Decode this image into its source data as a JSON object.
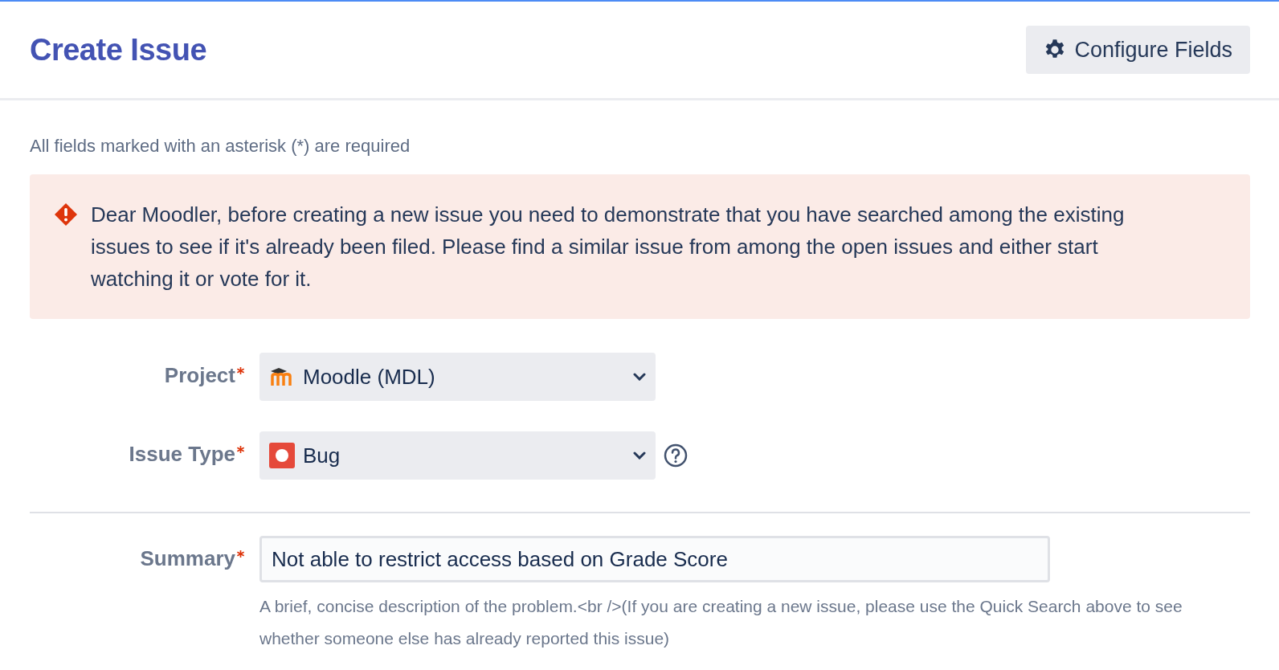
{
  "header": {
    "title": "Create Issue",
    "configure_button": "Configure Fields"
  },
  "required_note": "All fields marked with an asterisk (*) are required",
  "alert": {
    "kind": "error",
    "message": "Dear Moodler, before creating a new issue you need to demonstrate that you have searched among the existing issues to see if it's already been filed. Please find a similar issue from among the open issues and either start watching it or vote for it."
  },
  "sections": [
    [
      {
        "kind": "project-select",
        "label": "Project",
        "required": true,
        "value": "Moodle (MDL)"
      },
      {
        "kind": "type-select",
        "label": "Issue Type",
        "required": true,
        "value": "Bug",
        "help": true
      }
    ],
    [
      {
        "kind": "text",
        "label": "Summary",
        "required": true,
        "value": "Not able to restrict access based on Grade Score",
        "hint": "A brief, concise description of the problem.<br />(If you are creating a new issue, please use the Quick Search above to see whether someone else has already reported this issue)"
      }
    ]
  ]
}
